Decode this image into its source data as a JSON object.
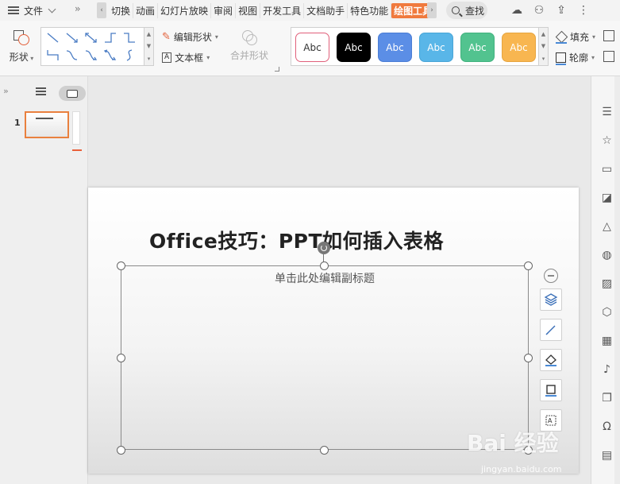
{
  "menu": {
    "file_label": "文件"
  },
  "tabs": [
    "切换",
    "动画",
    "幻灯片放映",
    "审阅",
    "视图",
    "开发工具",
    "文档助手",
    "特色功能",
    "绘图工具"
  ],
  "active_tab": "绘图工具",
  "search": {
    "label": "查找"
  },
  "ribbon": {
    "shape_label": "形状",
    "edit_shape_label": "编辑形状",
    "textbox_label": "文本框",
    "merge_shape_label": "合并形状",
    "fill_label": "填充",
    "outline_label": "轮廓",
    "styles": [
      {
        "label": "Abc",
        "bg": "#ffffff",
        "fg": "#333333",
        "border": "#e0607a"
      },
      {
        "label": "Abc",
        "bg": "#000000",
        "fg": "#ffffff",
        "border": "#000000"
      },
      {
        "label": "Abc",
        "bg": "#5b8ee6",
        "fg": "#ffffff",
        "border": "#4a7dd5"
      },
      {
        "label": "Abc",
        "bg": "#59b6e8",
        "fg": "#ffffff",
        "border": "#48a5d7"
      },
      {
        "label": "Abc",
        "bg": "#52c38f",
        "fg": "#ffffff",
        "border": "#41b27e"
      },
      {
        "label": "Abc",
        "bg": "#f8b650",
        "fg": "#ffffff",
        "border": "#e7a53f"
      }
    ]
  },
  "thumbnails": {
    "slide_number": "1"
  },
  "slide": {
    "title": "Office技巧：PPT如何插入表格",
    "subtitle_placeholder": "单击此处编辑副标题"
  },
  "colors": {
    "accent": "#f07a3e",
    "selection": "#8a8a8a"
  },
  "watermark": {
    "brand": "Bai 经验",
    "url": "jingyan.baidu.com"
  }
}
